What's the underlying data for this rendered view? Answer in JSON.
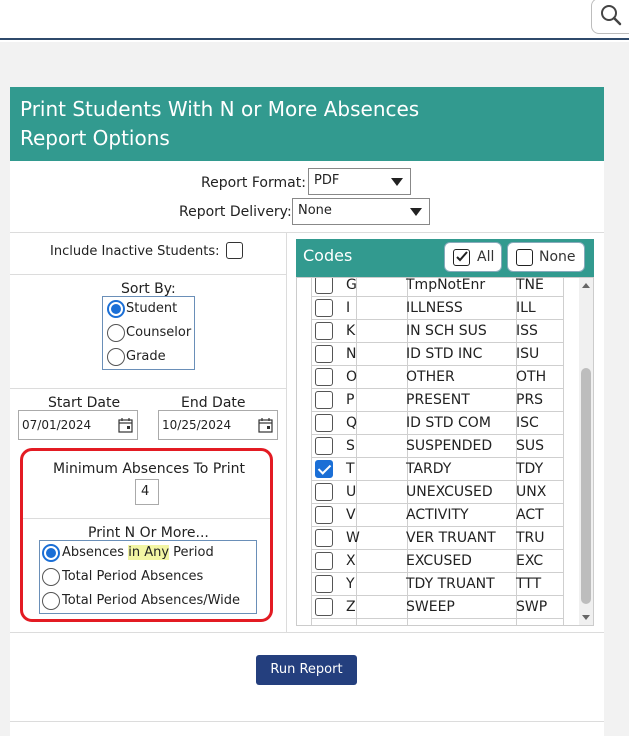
{
  "header": {
    "line1": "Print Students With N or More Absences",
    "line2": "Report Options"
  },
  "report_format": {
    "label": "Report Format:",
    "value": "PDF"
  },
  "report_delivery": {
    "label": "Report Delivery:",
    "value": "None"
  },
  "include_inactive": {
    "label": "Include Inactive Students:",
    "checked": false
  },
  "sort_by": {
    "label": "Sort By:",
    "options": [
      "Student",
      "Counselor",
      "Grade"
    ],
    "selected": "Student"
  },
  "start_date": {
    "label": "Start Date",
    "value": "07/01/2024"
  },
  "end_date": {
    "label": "End Date",
    "value": "10/25/2024"
  },
  "min_absences": {
    "label": "Minimum Absences To Print",
    "value": "4"
  },
  "print_n_or_more": {
    "label": "Print N Or More...",
    "options": [
      {
        "pre": "Absences ",
        "hl": "in Any",
        "post": " Period"
      },
      {
        "pre": "Total Period Absences",
        "hl": "",
        "post": ""
      },
      {
        "pre": "Total Period Absences/Wide",
        "hl": "",
        "post": ""
      }
    ],
    "selected_index": 0
  },
  "codes": {
    "title": "Codes",
    "all_label": "All",
    "none_label": "None",
    "rows": [
      {
        "code": "G",
        "desc": "TmpNotEnr",
        "abbr": "TNE",
        "checked": false
      },
      {
        "code": "I",
        "desc": "ILLNESS",
        "abbr": "ILL",
        "checked": false
      },
      {
        "code": "K",
        "desc": "IN SCH SUS",
        "abbr": "ISS",
        "checked": false
      },
      {
        "code": "N",
        "desc": "ID STD INC",
        "abbr": "ISU",
        "checked": false
      },
      {
        "code": "O",
        "desc": "OTHER",
        "abbr": "OTH",
        "checked": false
      },
      {
        "code": "P",
        "desc": "PRESENT",
        "abbr": "PRS",
        "checked": false
      },
      {
        "code": "Q",
        "desc": "ID STD COM",
        "abbr": "ISC",
        "checked": false
      },
      {
        "code": "S",
        "desc": "SUSPENDED",
        "abbr": "SUS",
        "checked": false
      },
      {
        "code": "T",
        "desc": "TARDY",
        "abbr": "TDY",
        "checked": true
      },
      {
        "code": "U",
        "desc": "UNEXCUSED",
        "abbr": "UNX",
        "checked": false
      },
      {
        "code": "V",
        "desc": "ACTIVITY",
        "abbr": "ACT",
        "checked": false
      },
      {
        "code": "W",
        "desc": "VER TRUANT",
        "abbr": "TRU",
        "checked": false
      },
      {
        "code": "X",
        "desc": "EXCUSED",
        "abbr": "EXC",
        "checked": false
      },
      {
        "code": "Y",
        "desc": "TDY TRUANT",
        "abbr": "TTT",
        "checked": false
      },
      {
        "code": "Z",
        "desc": "SWEEP",
        "abbr": "SWP",
        "checked": false
      }
    ]
  },
  "run_button": {
    "label": "Run Report"
  },
  "colors": {
    "header": "#329a8f",
    "run_button": "#243f7e",
    "highlight_box": "#e31b23",
    "selected": "#1b6fd6"
  }
}
